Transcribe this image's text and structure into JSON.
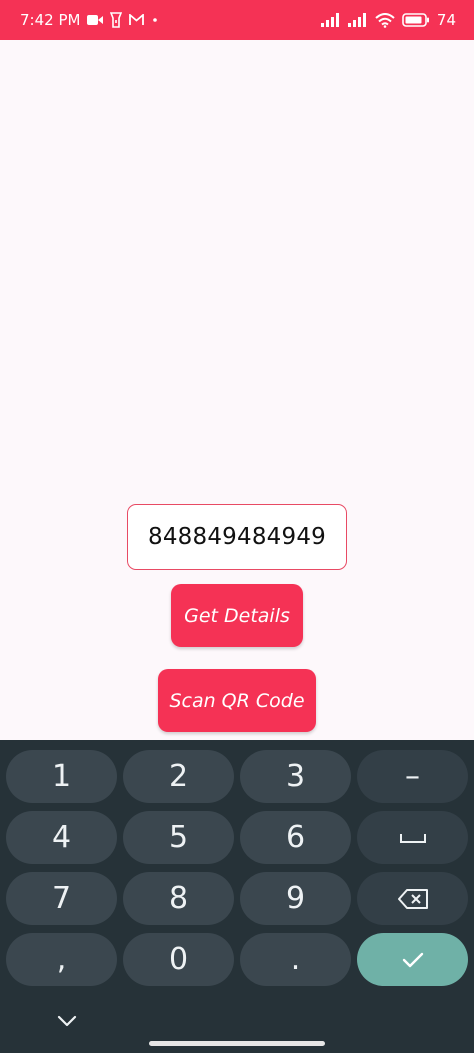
{
  "status_bar": {
    "time": "7:42 PM",
    "battery": "74",
    "left_icons": [
      "video-call-icon",
      "flashlight-icon",
      "gmail-icon",
      "dot-icon"
    ],
    "right_icons": [
      "signal-icon",
      "signal-icon",
      "wifi-icon",
      "battery-icon"
    ]
  },
  "form": {
    "number_value": "848849484949",
    "get_details_label": "Get Details",
    "scan_qr_label": "Scan QR Code"
  },
  "keyboard": {
    "row1": [
      "1",
      "2",
      "3",
      "–"
    ],
    "row2": [
      "4",
      "5",
      "6"
    ],
    "row3": [
      "7",
      "8",
      "9"
    ],
    "row4": [
      ",",
      "0",
      "."
    ],
    "icons": {
      "space": "space-icon",
      "backspace": "backspace-icon",
      "enter": "check-icon",
      "collapse": "chevron-down-icon"
    }
  },
  "colors": {
    "accent": "#f53255",
    "keyboard_bg": "#263238",
    "key_bg": "#3b474f",
    "enter_key": "#6fb1a7"
  }
}
